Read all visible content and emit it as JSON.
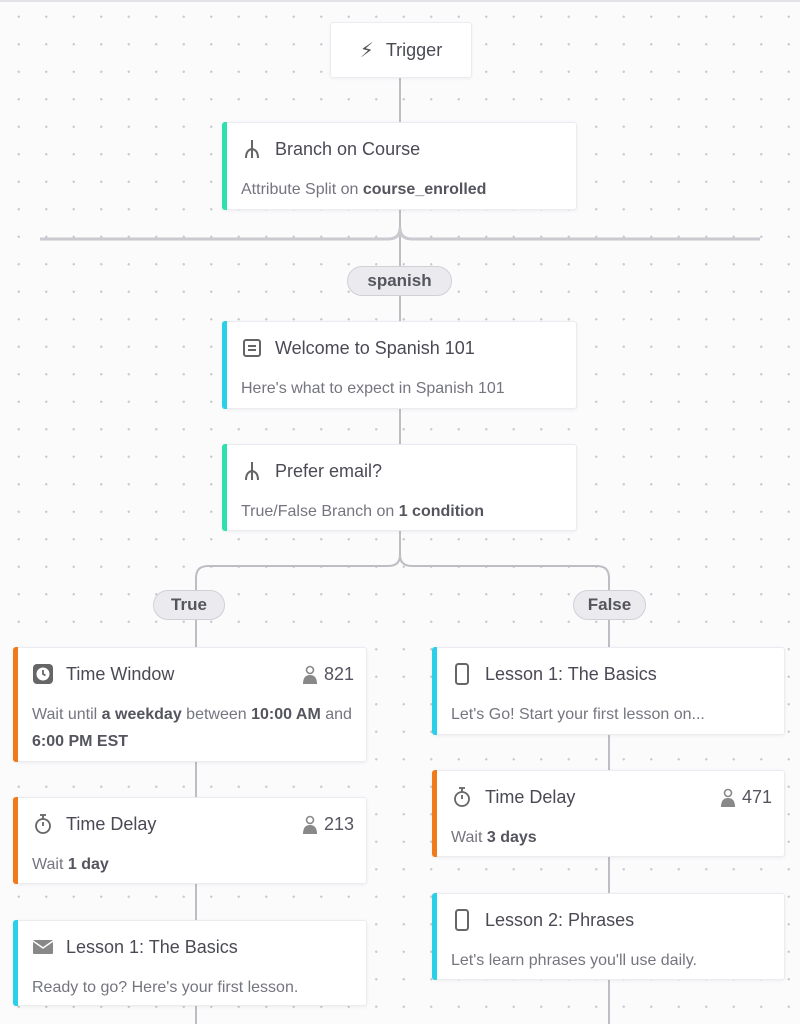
{
  "colors": {
    "branch_accent": "#2ee0b0",
    "message_accent": "#2ad0e8",
    "delay_accent": "#f07a1a",
    "connector": "#bdbdc4"
  },
  "trigger": {
    "label": "Trigger",
    "icon": "lightning-icon"
  },
  "branch_labels": {
    "spanish": "spanish",
    "true": "True",
    "false": "False"
  },
  "cards": [
    {
      "id": "branch-on-course",
      "icon": "branch-icon",
      "accent": "branch",
      "title": "Branch on Course",
      "subtitle": [
        {
          "t": "Attribute Split on "
        },
        {
          "t": "course_enrolled",
          "b": true
        }
      ]
    },
    {
      "id": "welcome-spanish",
      "icon": "email-template-icon",
      "accent": "message",
      "title": "Welcome to Spanish 101",
      "subtitle": [
        {
          "t": "Here's what to expect in Spanish 101"
        }
      ]
    },
    {
      "id": "prefer-email",
      "icon": "branch-icon",
      "accent": "branch",
      "title": "Prefer email?",
      "subtitle": [
        {
          "t": "True/False Branch on "
        },
        {
          "t": "1 condition",
          "b": true
        }
      ]
    },
    {
      "id": "time-window",
      "icon": "clock-icon",
      "accent": "delay",
      "title": "Time Window",
      "count": "821",
      "subtitle": [
        {
          "t": "Wait until "
        },
        {
          "t": "a weekday",
          "b": true
        },
        {
          "t": " between "
        },
        {
          "t": "10:00 AM",
          "b": true
        },
        {
          "t": " and "
        },
        {
          "t": "6:00 PM EST",
          "b": true
        }
      ]
    },
    {
      "id": "time-delay-left",
      "icon": "stopwatch-icon",
      "accent": "delay",
      "title": "Time Delay",
      "count": "213",
      "subtitle": [
        {
          "t": "Wait "
        },
        {
          "t": "1 day",
          "b": true
        }
      ]
    },
    {
      "id": "lesson1-email",
      "icon": "envelope-icon",
      "accent": "message",
      "title": "Lesson 1: The Basics",
      "subtitle": [
        {
          "t": "Ready to go? Here's your first lesson."
        }
      ]
    },
    {
      "id": "lesson1-push",
      "icon": "mobile-icon",
      "accent": "message",
      "title": "Lesson 1: The Basics",
      "subtitle": [
        {
          "t": "Let's Go! Start your first lesson on..."
        }
      ]
    },
    {
      "id": "time-delay-right",
      "icon": "stopwatch-icon",
      "accent": "delay",
      "title": "Time Delay",
      "count": "471",
      "subtitle": [
        {
          "t": "Wait "
        },
        {
          "t": "3 days",
          "b": true
        }
      ]
    },
    {
      "id": "lesson2-push",
      "icon": "mobile-icon",
      "accent": "message",
      "title": "Lesson 2: Phrases",
      "subtitle": [
        {
          "t": "Let's learn phrases you'll use daily."
        }
      ]
    }
  ]
}
